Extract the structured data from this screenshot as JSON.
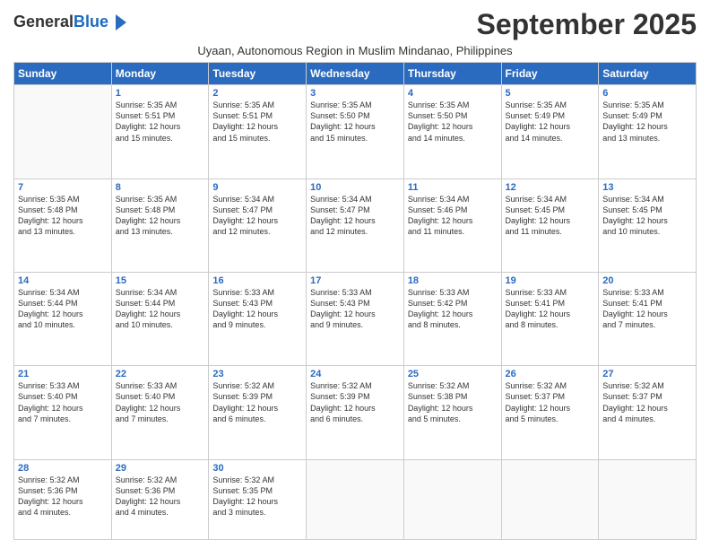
{
  "logo": {
    "general": "General",
    "blue": "Blue"
  },
  "header": {
    "month": "September 2025",
    "location": "Uyaan, Autonomous Region in Muslim Mindanao, Philippines"
  },
  "weekdays": [
    "Sunday",
    "Monday",
    "Tuesday",
    "Wednesday",
    "Thursday",
    "Friday",
    "Saturday"
  ],
  "weeks": [
    [
      {
        "day": "",
        "info": ""
      },
      {
        "day": "1",
        "info": "Sunrise: 5:35 AM\nSunset: 5:51 PM\nDaylight: 12 hours\nand 15 minutes."
      },
      {
        "day": "2",
        "info": "Sunrise: 5:35 AM\nSunset: 5:51 PM\nDaylight: 12 hours\nand 15 minutes."
      },
      {
        "day": "3",
        "info": "Sunrise: 5:35 AM\nSunset: 5:50 PM\nDaylight: 12 hours\nand 15 minutes."
      },
      {
        "day": "4",
        "info": "Sunrise: 5:35 AM\nSunset: 5:50 PM\nDaylight: 12 hours\nand 14 minutes."
      },
      {
        "day": "5",
        "info": "Sunrise: 5:35 AM\nSunset: 5:49 PM\nDaylight: 12 hours\nand 14 minutes."
      },
      {
        "day": "6",
        "info": "Sunrise: 5:35 AM\nSunset: 5:49 PM\nDaylight: 12 hours\nand 13 minutes."
      }
    ],
    [
      {
        "day": "7",
        "info": "Sunrise: 5:35 AM\nSunset: 5:48 PM\nDaylight: 12 hours\nand 13 minutes."
      },
      {
        "day": "8",
        "info": "Sunrise: 5:35 AM\nSunset: 5:48 PM\nDaylight: 12 hours\nand 13 minutes."
      },
      {
        "day": "9",
        "info": "Sunrise: 5:34 AM\nSunset: 5:47 PM\nDaylight: 12 hours\nand 12 minutes."
      },
      {
        "day": "10",
        "info": "Sunrise: 5:34 AM\nSunset: 5:47 PM\nDaylight: 12 hours\nand 12 minutes."
      },
      {
        "day": "11",
        "info": "Sunrise: 5:34 AM\nSunset: 5:46 PM\nDaylight: 12 hours\nand 11 minutes."
      },
      {
        "day": "12",
        "info": "Sunrise: 5:34 AM\nSunset: 5:45 PM\nDaylight: 12 hours\nand 11 minutes."
      },
      {
        "day": "13",
        "info": "Sunrise: 5:34 AM\nSunset: 5:45 PM\nDaylight: 12 hours\nand 10 minutes."
      }
    ],
    [
      {
        "day": "14",
        "info": "Sunrise: 5:34 AM\nSunset: 5:44 PM\nDaylight: 12 hours\nand 10 minutes."
      },
      {
        "day": "15",
        "info": "Sunrise: 5:34 AM\nSunset: 5:44 PM\nDaylight: 12 hours\nand 10 minutes."
      },
      {
        "day": "16",
        "info": "Sunrise: 5:33 AM\nSunset: 5:43 PM\nDaylight: 12 hours\nand 9 minutes."
      },
      {
        "day": "17",
        "info": "Sunrise: 5:33 AM\nSunset: 5:43 PM\nDaylight: 12 hours\nand 9 minutes."
      },
      {
        "day": "18",
        "info": "Sunrise: 5:33 AM\nSunset: 5:42 PM\nDaylight: 12 hours\nand 8 minutes."
      },
      {
        "day": "19",
        "info": "Sunrise: 5:33 AM\nSunset: 5:41 PM\nDaylight: 12 hours\nand 8 minutes."
      },
      {
        "day": "20",
        "info": "Sunrise: 5:33 AM\nSunset: 5:41 PM\nDaylight: 12 hours\nand 7 minutes."
      }
    ],
    [
      {
        "day": "21",
        "info": "Sunrise: 5:33 AM\nSunset: 5:40 PM\nDaylight: 12 hours\nand 7 minutes."
      },
      {
        "day": "22",
        "info": "Sunrise: 5:33 AM\nSunset: 5:40 PM\nDaylight: 12 hours\nand 7 minutes."
      },
      {
        "day": "23",
        "info": "Sunrise: 5:32 AM\nSunset: 5:39 PM\nDaylight: 12 hours\nand 6 minutes."
      },
      {
        "day": "24",
        "info": "Sunrise: 5:32 AM\nSunset: 5:39 PM\nDaylight: 12 hours\nand 6 minutes."
      },
      {
        "day": "25",
        "info": "Sunrise: 5:32 AM\nSunset: 5:38 PM\nDaylight: 12 hours\nand 5 minutes."
      },
      {
        "day": "26",
        "info": "Sunrise: 5:32 AM\nSunset: 5:37 PM\nDaylight: 12 hours\nand 5 minutes."
      },
      {
        "day": "27",
        "info": "Sunrise: 5:32 AM\nSunset: 5:37 PM\nDaylight: 12 hours\nand 4 minutes."
      }
    ],
    [
      {
        "day": "28",
        "info": "Sunrise: 5:32 AM\nSunset: 5:36 PM\nDaylight: 12 hours\nand 4 minutes."
      },
      {
        "day": "29",
        "info": "Sunrise: 5:32 AM\nSunset: 5:36 PM\nDaylight: 12 hours\nand 4 minutes."
      },
      {
        "day": "30",
        "info": "Sunrise: 5:32 AM\nSunset: 5:35 PM\nDaylight: 12 hours\nand 3 minutes."
      },
      {
        "day": "",
        "info": ""
      },
      {
        "day": "",
        "info": ""
      },
      {
        "day": "",
        "info": ""
      },
      {
        "day": "",
        "info": ""
      }
    ]
  ]
}
